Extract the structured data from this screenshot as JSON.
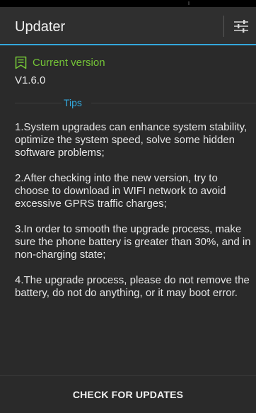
{
  "appbar": {
    "title": "Updater",
    "settings_icon": "sliders-icon"
  },
  "current_version": {
    "icon": "document-flag-icon",
    "label": "Current version",
    "value": "V1.6.0"
  },
  "tips": {
    "label": "Tips",
    "items": [
      "1.System upgrades can enhance system stability, optimize the system speed, solve some hidden software problems;",
      "2.After checking into the new version, try to choose to download in WIFI network to avoid excessive GPRS traffic charges;",
      "3.In order to smooth the upgrade process, make sure the phone battery is greater than 30%, and in non-charging state;",
      "4.The upgrade process, please do not remove the battery, do not do anything, or it may boot error."
    ]
  },
  "footer": {
    "button_label": "CHECK FOR UPDATES"
  },
  "colors": {
    "accent": "#33a8dd",
    "green": "#74c437",
    "background": "#2a2a2a"
  }
}
